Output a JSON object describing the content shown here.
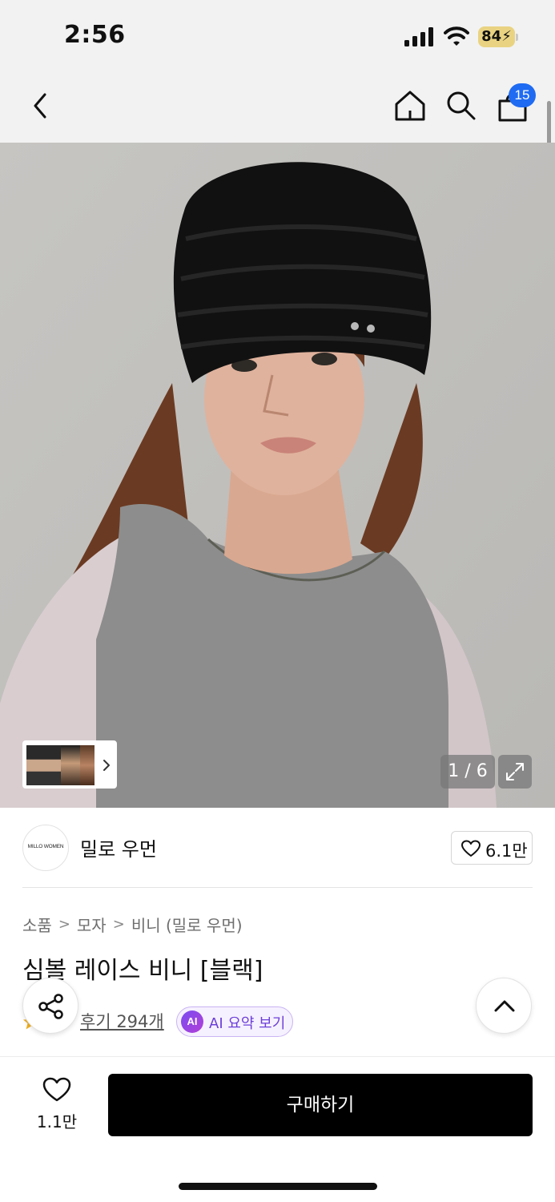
{
  "status_bar": {
    "time": "2:56",
    "battery": "84",
    "icons": [
      "signal-icon",
      "wifi-icon",
      "battery-charging-icon"
    ]
  },
  "nav": {
    "icons": [
      "back-icon",
      "home-icon",
      "search-icon",
      "cart-icon"
    ],
    "cart_count": "15"
  },
  "gallery": {
    "counter": "1 / 6",
    "current": 1,
    "total": 6,
    "icons": [
      "expand-icon",
      "chevron-right-icon"
    ]
  },
  "brand": {
    "logo_text": "MILLO WOMEN",
    "name": "밀로 우먼",
    "likes": "6.1만"
  },
  "breadcrumb": [
    "소품",
    "모자",
    "비니 (밀로 우먼)"
  ],
  "product": {
    "title": "심볼 레이스 비니 [블랙]",
    "reviews": "후기 294개",
    "ai_badge": "AI",
    "ai_summary": "AI 요약 보기"
  },
  "bottom_bar": {
    "wish_count": "1.1만",
    "buy_label": "구매하기"
  },
  "colors": {
    "accent": "#1f6bf2",
    "ai_purple": "#6c3fd8",
    "buy_button": "#000000"
  }
}
